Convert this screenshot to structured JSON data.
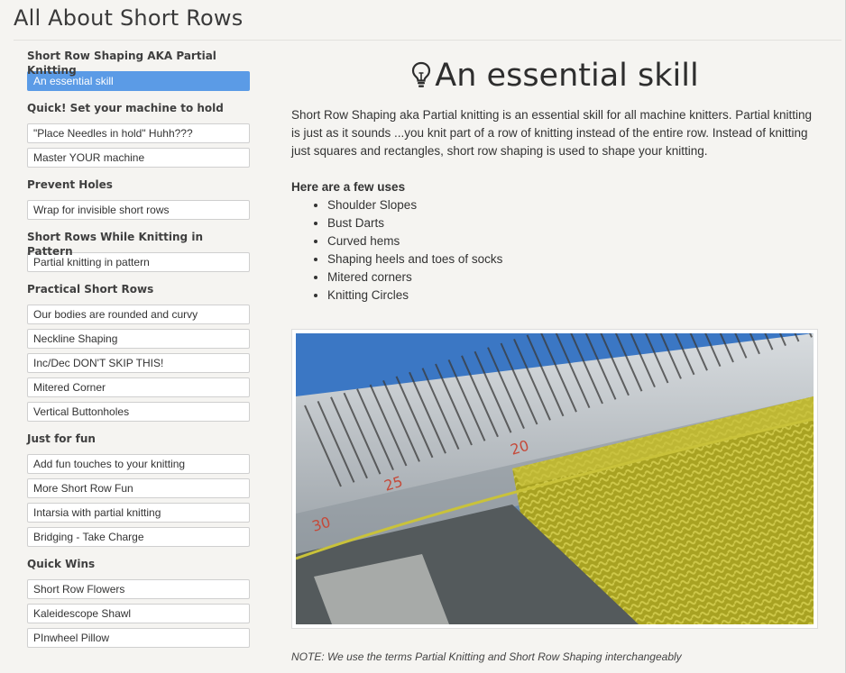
{
  "page": {
    "title": "All About Short Rows"
  },
  "sidebar": {
    "groups": [
      {
        "heading": "Short Row Shaping AKA Partial Knitting",
        "items": [
          {
            "label": "An essential skill",
            "active": true
          }
        ]
      },
      {
        "heading": "Quick! Set your machine to hold",
        "items": [
          {
            "label": "\"Place Needles in hold\" Huhh???"
          },
          {
            "label": "Master YOUR machine"
          }
        ]
      },
      {
        "heading": "Prevent Holes",
        "items": [
          {
            "label": "Wrap for invisible short rows"
          }
        ]
      },
      {
        "heading": "Short Rows While Knitting in Pattern",
        "items": [
          {
            "label": "Partial knitting in pattern"
          }
        ]
      },
      {
        "heading": "Practical Short Rows",
        "items": [
          {
            "label": "Our bodies are rounded and curvy"
          },
          {
            "label": "Neckline Shaping"
          },
          {
            "label": "Inc/Dec DON'T SKIP THIS!"
          },
          {
            "label": "Mitered Corner"
          },
          {
            "label": "Vertical Buttonholes"
          }
        ]
      },
      {
        "heading": "Just for fun",
        "items": [
          {
            "label": "Add fun touches to your knitting"
          },
          {
            "label": "More Short Row Fun"
          },
          {
            "label": "Intarsia with partial knitting"
          },
          {
            "label": "Bridging - Take Charge"
          }
        ]
      },
      {
        "heading": "Quick Wins",
        "items": [
          {
            "label": "Short Row Flowers"
          },
          {
            "label": "Kaleidescope Shawl"
          },
          {
            "label": "PInwheel Pillow"
          }
        ]
      }
    ]
  },
  "main": {
    "heading": "An essential skill",
    "heading_icon": "lightbulb-icon",
    "intro": "Short Row Shaping aka Partial knitting is an essential skill for all machine knitters. Partial knitting is just as it sounds ...you knit part of a row of knitting instead of the entire row. Instead of knitting just squares and rectangles, short row shaping is used to shape your knitting.",
    "uses_heading": "Here are a few uses",
    "uses": [
      "Shoulder Slopes",
      "Bust Darts",
      "Curved hems",
      "Shaping heels and toes of socks",
      "Mitered corners",
      "Knitting Circles"
    ],
    "photo_numbers": [
      "20",
      "25",
      "30"
    ],
    "note": "NOTE: We use the terms Partial Knitting and Short Row Shaping interchangeably"
  },
  "colors": {
    "active_item": "#5b9be6",
    "page_background": "#f5f4f1",
    "yarn": "#b4b028",
    "photo_background": "#3b77c4"
  }
}
